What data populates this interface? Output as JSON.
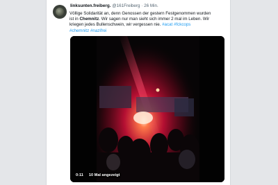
{
  "tweet": {
    "author_name": "linksunten.freiberg.",
    "author_handle": "@161Freiberg",
    "separator": "·",
    "timestamp": "26 Min.",
    "text_line1": "Völlige Solidarität an, denn Genossen der gestern Festgenommen wurden",
    "text_line2_prefix": "ist in ",
    "text_line2_strong": "Chemnitz",
    "text_line2_rest": ". Wir sagen nur man sieht sich immer 2 mal im Leben. Wir",
    "text_line3": "kriegen jedes Bullenschwein, wir vergessen nie. ",
    "hashtags": [
      "#acat",
      "#fckcops",
      "#chemnitz",
      "#nazifrei"
    ]
  },
  "video": {
    "timecode": "0:11",
    "views": "10 Mal angezeigt"
  },
  "colors": {
    "link": "#1d9bf0",
    "background": "#e4e6e9",
    "smoke": "#d8143a"
  },
  "icons": {
    "avatar": "profile-photo"
  }
}
